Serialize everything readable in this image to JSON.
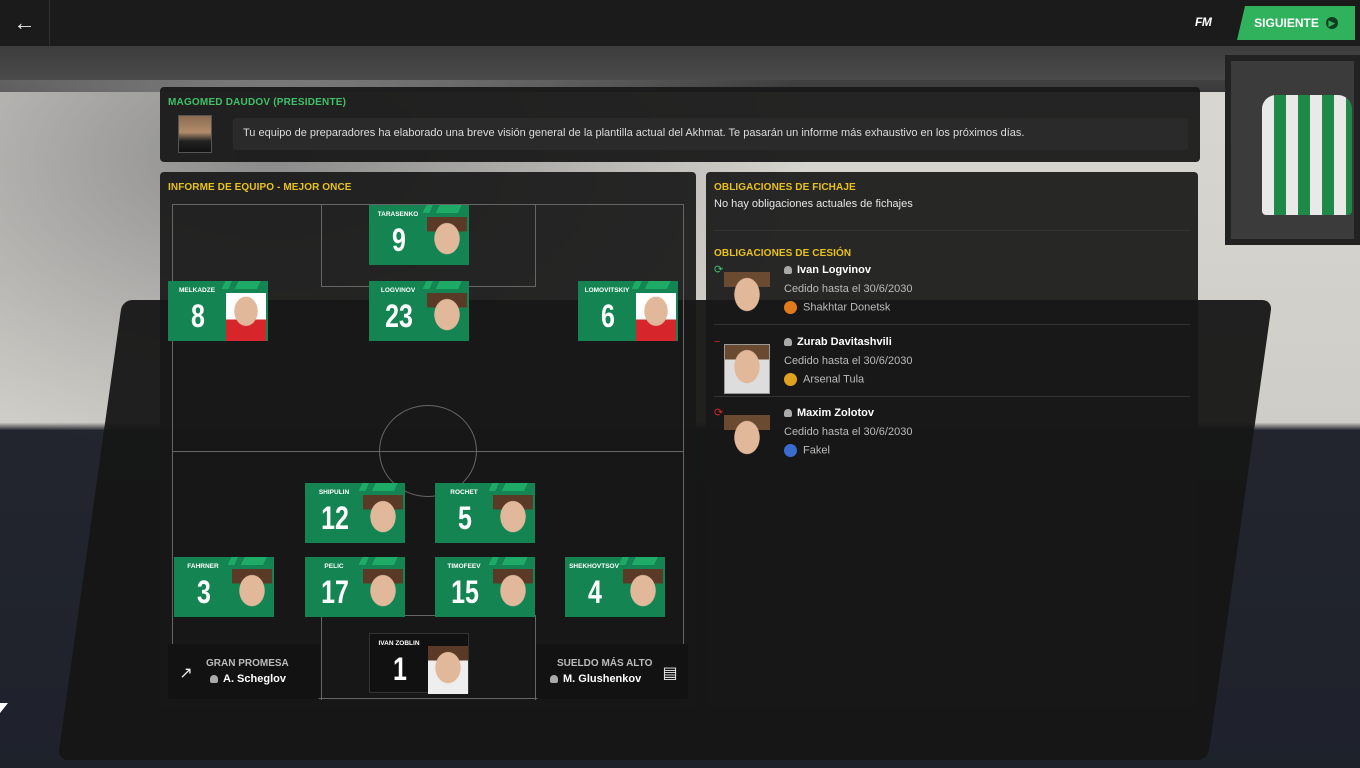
{
  "topbar": {
    "back_icon": "arrow-left-icon",
    "logo_text": "FM",
    "next_label": "SIGUIENTE",
    "next_icon": "arrow-right-circle-icon"
  },
  "message": {
    "sender": "MAGOMED DAUDOV (PRESIDENTE)",
    "text": "Tu equipo de preparadores ha elaborado una breve visión general de la plantilla actual del Akhmat. Te pasarán un informe más exhaustivo en los próximos días."
  },
  "team_report": {
    "title": "INFORME DE EQUIPO - MEJOR ONCE",
    "players": [
      {
        "name": "TARASENKO",
        "number": "9"
      },
      {
        "name": "MELKADZE",
        "number": "8"
      },
      {
        "name": "LOGVINOV",
        "number": "23"
      },
      {
        "name": "LOMOVITSKIY",
        "number": "6"
      },
      {
        "name": "SHIPULIN",
        "number": "12"
      },
      {
        "name": "ROCHET",
        "number": "5"
      },
      {
        "name": "FAHRNER",
        "number": "3"
      },
      {
        "name": "PELIC",
        "number": "17"
      },
      {
        "name": "TIMOFEEV",
        "number": "15"
      },
      {
        "name": "SHEKHOVTSOV",
        "number": "4"
      },
      {
        "name": "IVAN ZOBLIN",
        "number": "1"
      }
    ],
    "prospect": {
      "label": "GRAN PROMESA",
      "player": "A. Scheglov"
    },
    "top_salary": {
      "label": "SUELDO MÁS ALTO",
      "player": "M. Glushenkov"
    }
  },
  "signing_obligations": {
    "title": "OBLIGACIONES DE FICHAJE",
    "text": "No hay obligaciones actuales de fichajes"
  },
  "loan_obligations": {
    "title": "OBLIGACIONES DE CESIÓN",
    "loans": [
      {
        "name": "Ivan Logvinov",
        "until": "Cedido hasta el 30/6/2030",
        "club": "Shakhtar Donetsk",
        "club_color": "#e07a1c",
        "status_color": "#3ec16a"
      },
      {
        "name": "Zurab Davitashvili",
        "until": "Cedido hasta el 30/6/2030",
        "club": "Arsenal Tula",
        "club_color": "#e0a020",
        "status_color": "#d8262b"
      },
      {
        "name": "Maxim Zolotov",
        "until": "Cedido hasta el 30/6/2030",
        "club": "Fakel",
        "club_color": "#3a6ccf",
        "status_color": "#d8262b"
      }
    ]
  }
}
